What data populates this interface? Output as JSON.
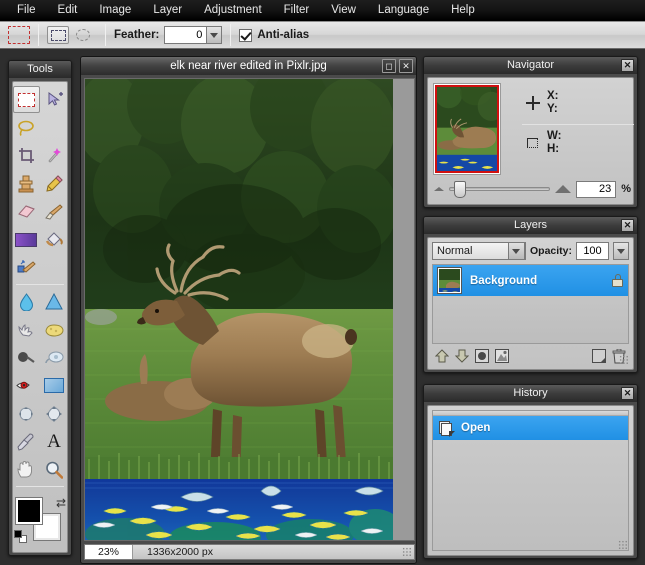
{
  "app": {
    "menu": [
      {
        "label": "File"
      },
      {
        "label": "Edit"
      },
      {
        "label": "Image"
      },
      {
        "label": "Layer"
      },
      {
        "label": "Adjustment"
      },
      {
        "label": "Filter"
      },
      {
        "label": "View"
      },
      {
        "label": "Language"
      },
      {
        "label": "Help"
      }
    ]
  },
  "options_bar": {
    "tool_icon": "rectangular-marquee-icon",
    "selection_modes": [
      {
        "name": "rectangular-selection",
        "icon": "rectangle-dashed-icon",
        "active": true
      },
      {
        "name": "elliptical-selection",
        "icon": "ellipse-dashed-icon",
        "active": false
      }
    ],
    "feather_label": "Feather:",
    "feather_value": "0",
    "antialias_label": "Anti-alias",
    "antialias_checked": true
  },
  "tools_panel": {
    "title": "Tools",
    "tools": [
      {
        "name": "rectangular-marquee-tool",
        "icon": "marquee-icon",
        "glyph": "",
        "selected": true
      },
      {
        "name": "move-tool",
        "icon": "arrow-move-icon",
        "glyph": "➤"
      },
      {
        "name": "lasso-tool",
        "icon": "lasso-icon",
        "glyph": "◯"
      },
      {
        "name": "wand-spacer",
        "icon": "blank-icon",
        "glyph": ""
      },
      {
        "name": "crop-tool",
        "icon": "crop-icon",
        "glyph": "⌗"
      },
      {
        "name": "magic-wand-tool",
        "icon": "magic-wand-icon",
        "glyph": "✧"
      },
      {
        "name": "clone-stamp-tool",
        "icon": "stamp-icon",
        "glyph": "⚑"
      },
      {
        "name": "pencil-tool",
        "icon": "pencil-icon",
        "glyph": "✎"
      },
      {
        "name": "eraser-tool",
        "icon": "eraser-icon",
        "glyph": "▰"
      },
      {
        "name": "brush-tool",
        "icon": "paintbrush-icon",
        "glyph": "✒"
      },
      {
        "name": "gradient-fill-tool",
        "icon": "gradient-swatch-icon",
        "glyph": "▬"
      },
      {
        "name": "paint-bucket-tool",
        "icon": "paint-bucket-icon",
        "glyph": "◕"
      },
      {
        "name": "replace-color-tool",
        "icon": "color-replace-brush-icon",
        "glyph": "✐"
      },
      {
        "name": "drawing-spacer",
        "icon": "blank-icon",
        "glyph": ""
      },
      {
        "name": "blur-tool",
        "icon": "waterdrop-icon",
        "glyph": "◆"
      },
      {
        "name": "sharpen-tool",
        "icon": "triangle-icon",
        "glyph": "▲"
      },
      {
        "name": "smudge-tool",
        "icon": "smudge-finger-icon",
        "glyph": "☚"
      },
      {
        "name": "sponge-tool",
        "icon": "sponge-icon",
        "glyph": "⬟"
      },
      {
        "name": "burn-tool",
        "icon": "burn-hand-icon",
        "glyph": "⚫"
      },
      {
        "name": "dodge-tool",
        "icon": "dodge-hand-icon",
        "glyph": "○"
      },
      {
        "name": "red-eye-tool",
        "icon": "red-eye-icon",
        "glyph": "◉"
      },
      {
        "name": "doodle-tool",
        "icon": "blue-rectangle-icon",
        "glyph": "■"
      },
      {
        "name": "pinch-tool",
        "icon": "pinch-icon",
        "glyph": "⬤"
      },
      {
        "name": "bloat-tool",
        "icon": "bloat-icon",
        "glyph": "✹"
      },
      {
        "name": "color-picker-tool",
        "icon": "eyedropper-icon",
        "glyph": "⚗"
      },
      {
        "name": "type-tool",
        "icon": "text-a-icon",
        "glyph": "A"
      },
      {
        "name": "hand-tool",
        "icon": "hand-icon",
        "glyph": "✋"
      },
      {
        "name": "zoom-tool",
        "icon": "magnifier-icon",
        "glyph": "⌕"
      }
    ],
    "foreground_color": "#000000",
    "background_color": "#ffffff",
    "swap_icon": "swap-colors-icon",
    "reset_icon": "reset-colors-icon"
  },
  "document": {
    "title": "elk near river edited in Pixlr.jpg",
    "maximize_icon": "maximize-icon",
    "close_icon": "close-icon",
    "zoom_percent": "23%",
    "dimensions": "1336x2000 px",
    "resize_grip": "resize-grip-icon"
  },
  "navigator": {
    "title": "Navigator",
    "close_icon": "close-icon",
    "position_icon": "crosshair-icon",
    "x_label": "X:",
    "y_label": "Y:",
    "size_icon": "selection-rect-icon",
    "w_label": "W:",
    "h_label": "H:",
    "zoom_out_icon": "small-triangle-icon",
    "zoom_in_icon": "large-triangle-icon",
    "zoom_value": "23",
    "percent_symbol": "%"
  },
  "layers": {
    "title": "Layers",
    "close_icon": "close-icon",
    "blend_mode": "Normal",
    "blend_arrow_icon": "chevron-down-icon",
    "opacity_label": "Opacity:",
    "opacity_value": "100",
    "opacity_arrow_icon": "chevron-down-icon",
    "items": [
      {
        "name": "Background",
        "locked": true,
        "selected": true,
        "lock_icon": "lock-icon"
      }
    ],
    "buttons": [
      {
        "name": "move-layer-up-button",
        "icon": "arrow-up-icon",
        "glyph": "⇧"
      },
      {
        "name": "move-layer-down-button",
        "icon": "arrow-down-icon",
        "glyph": "⇩"
      },
      {
        "name": "layer-mask-button",
        "icon": "circle-mask-icon",
        "glyph": "◉"
      },
      {
        "name": "layer-styles-button",
        "icon": "layer-styles-icon",
        "glyph": "❖"
      },
      {
        "name": "new-layer-button",
        "icon": "new-layer-icon",
        "glyph": "❐"
      },
      {
        "name": "delete-layer-button",
        "icon": "trash-icon",
        "glyph": "🗑"
      }
    ]
  },
  "history": {
    "title": "History",
    "close_icon": "close-icon",
    "items": [
      {
        "name": "Open",
        "icon": "open-document-icon",
        "selected": true
      }
    ],
    "resize_grip": "resize-grip-icon"
  },
  "colors": {
    "accent_blue": "#2090e4",
    "panel_gray": "#c2c2c2",
    "chrome_dark": "#2e2e2e",
    "marquee_red": "#c23030"
  }
}
